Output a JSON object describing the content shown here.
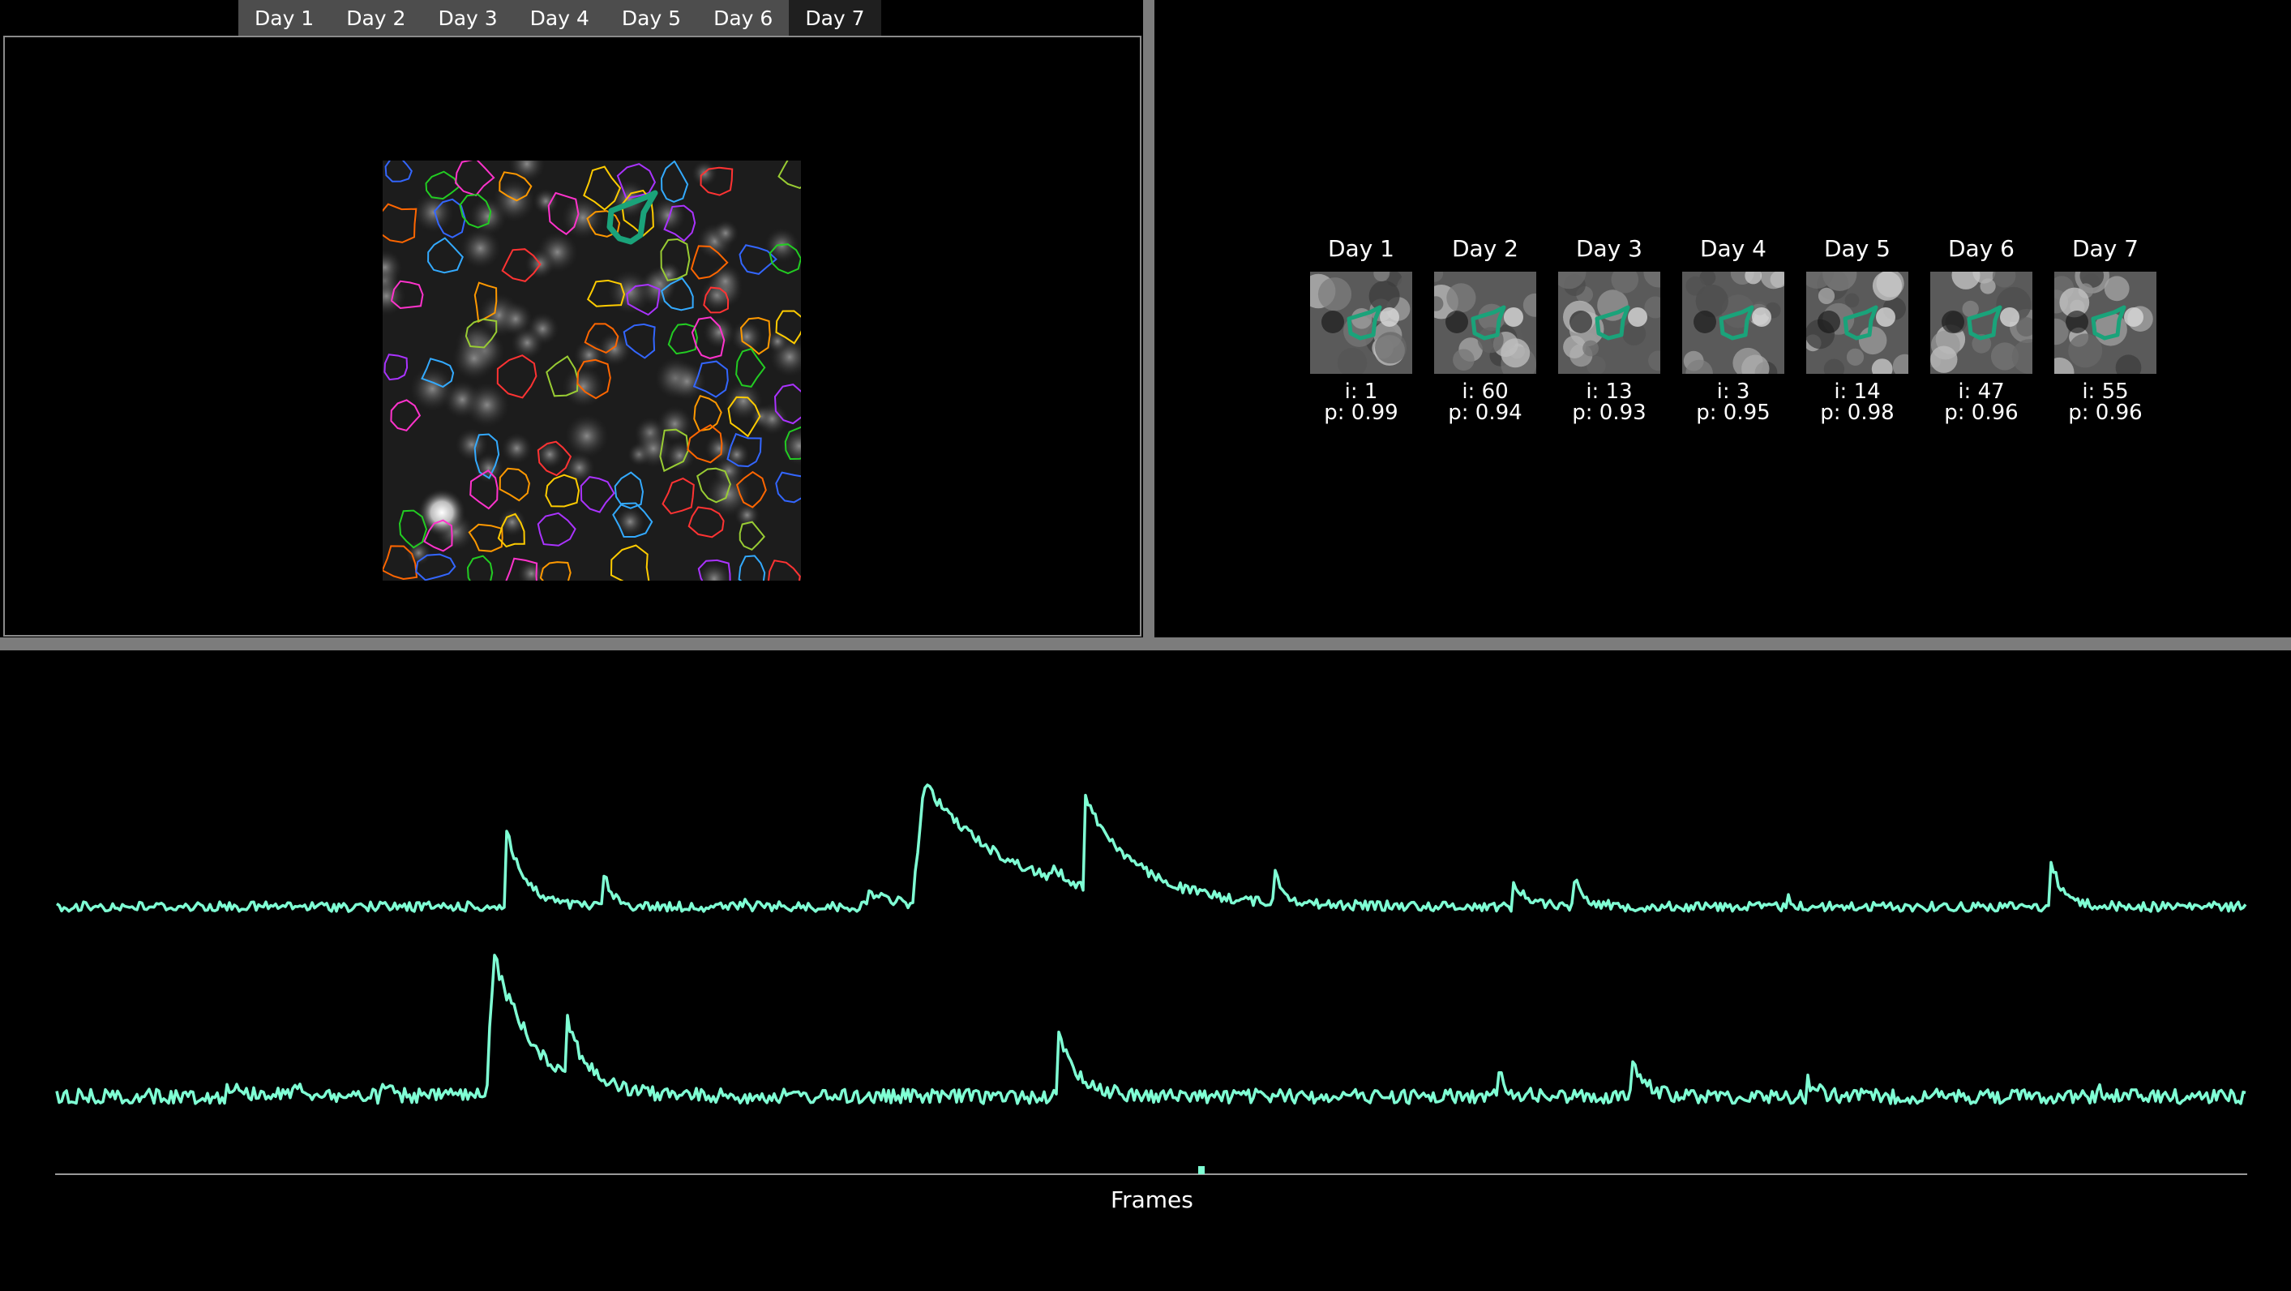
{
  "tabs": [
    "Day 1",
    "Day 2",
    "Day 3",
    "Day 4",
    "Day 5",
    "Day 6",
    "Day 7"
  ],
  "active_tab": "Day 7",
  "thumbnails": [
    {
      "day": "Day 1",
      "i": "i: 1",
      "p": "p: 0.99"
    },
    {
      "day": "Day 2",
      "i": "i: 60",
      "p": "p: 0.94"
    },
    {
      "day": "Day 3",
      "i": "i: 13",
      "p": "p: 0.93"
    },
    {
      "day": "Day 4",
      "i": "i: 3",
      "p": "p: 0.95"
    },
    {
      "day": "Day 5",
      "i": "i: 14",
      "p": "p: 0.98"
    },
    {
      "day": "Day 6",
      "i": "i: 47",
      "p": "p: 0.96"
    },
    {
      "day": "Day 7",
      "i": "i: 55",
      "p": "p: 0.96"
    }
  ],
  "trace_panel": {
    "xlabel": "Frames"
  },
  "colors": {
    "trace": "#7fffd4",
    "roi_selected": "#1aa37a",
    "tab_bg": "#4d4d4d",
    "tab_active_bg": "#1f1f1f",
    "splitter": "#7c7c7c"
  },
  "icons": []
}
